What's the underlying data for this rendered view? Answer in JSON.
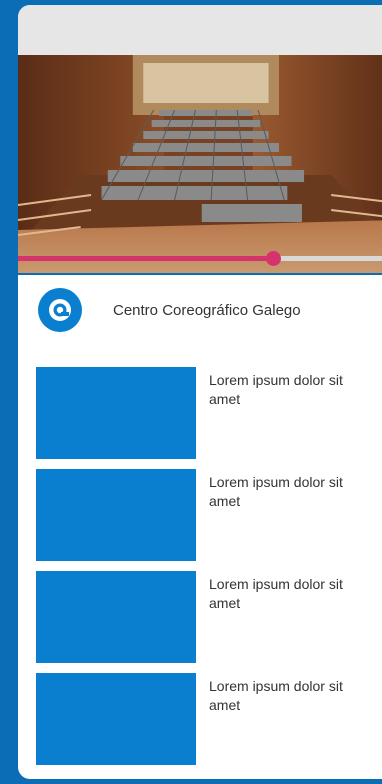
{
  "player": {
    "progress": 0.67
  },
  "venue": {
    "name": "Centro Coreográfico Galego",
    "logo_icon": "at-sign-logo-icon"
  },
  "items": [
    {
      "title": "Lorem ipsum dolor sit amet"
    },
    {
      "title": "Lorem ipsum dolor sit amet"
    },
    {
      "title": "Lorem ipsum dolor sit amet"
    },
    {
      "title": "Lorem ipsum dolor sit amet"
    }
  ],
  "colors": {
    "accent": "#0a6db5",
    "thumbnail": "#0a7fd0",
    "progress": "#d6336c"
  }
}
